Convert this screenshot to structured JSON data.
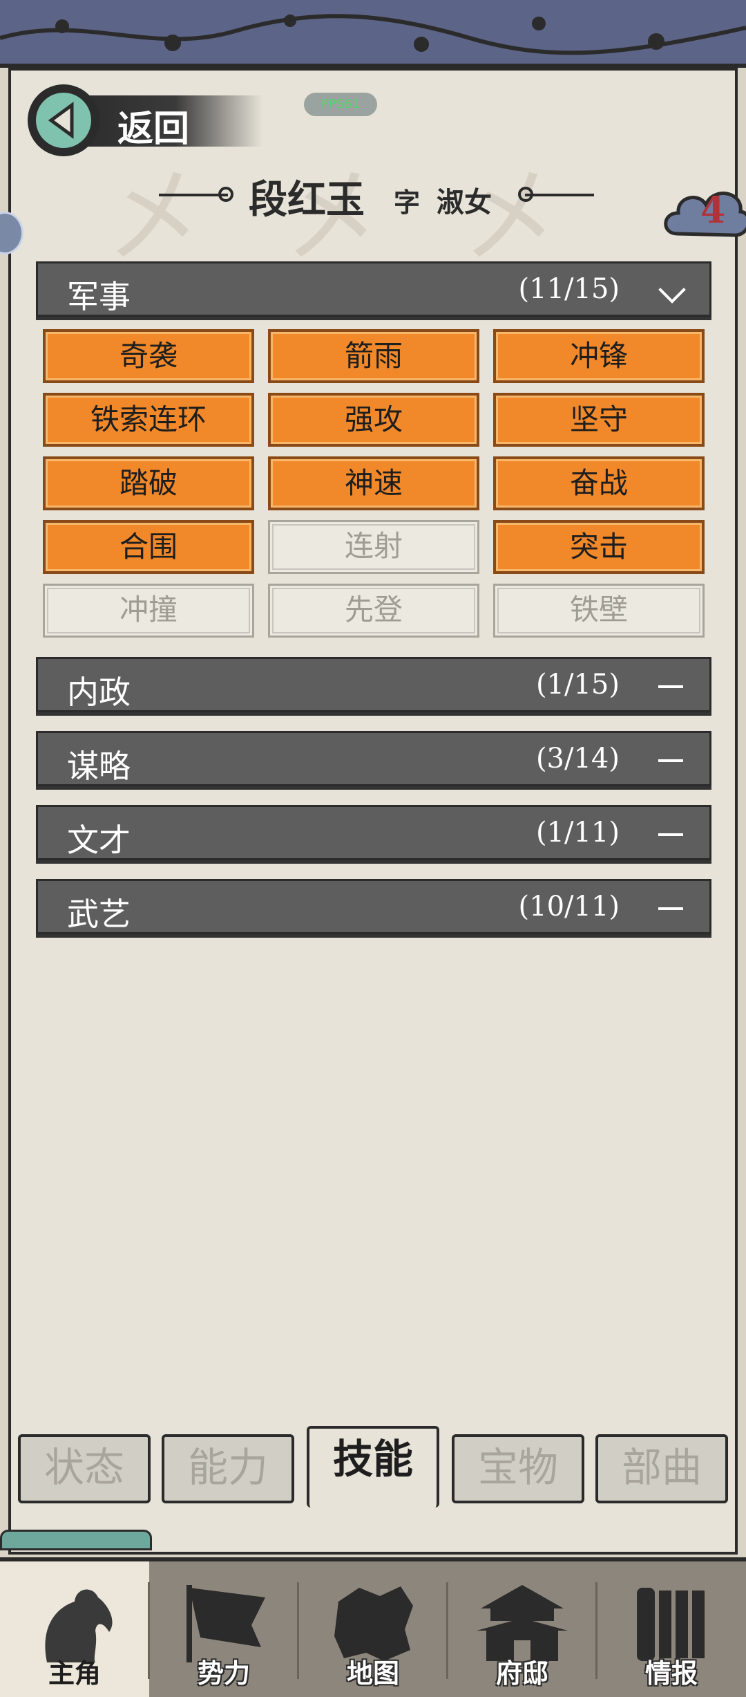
{
  "status": {
    "fps": "FPS61"
  },
  "header": {
    "back_label": "返回",
    "name": "段红玉",
    "courtesy_label": "字",
    "courtesy_name": "淑女",
    "badge_count": "4"
  },
  "sections": [
    {
      "label": "军事",
      "count": "(11/15)",
      "expanded": true
    },
    {
      "label": "内政",
      "count": "(1/15)",
      "expanded": false
    },
    {
      "label": "谋略",
      "count": "(3/14)",
      "expanded": false
    },
    {
      "label": "文才",
      "count": "(1/11)",
      "expanded": false
    },
    {
      "label": "武艺",
      "count": "(10/11)",
      "expanded": false
    }
  ],
  "military_skills": [
    {
      "name": "奇袭",
      "learned": true
    },
    {
      "name": "箭雨",
      "learned": true
    },
    {
      "name": "冲锋",
      "learned": true
    },
    {
      "name": "铁索连环",
      "learned": true
    },
    {
      "name": "强攻",
      "learned": true
    },
    {
      "name": "坚守",
      "learned": true
    },
    {
      "name": "踏破",
      "learned": true
    },
    {
      "name": "神速",
      "learned": true
    },
    {
      "name": "奋战",
      "learned": true
    },
    {
      "name": "合围",
      "learned": true
    },
    {
      "name": "连射",
      "learned": false
    },
    {
      "name": "突击",
      "learned": true
    },
    {
      "name": "冲撞",
      "learned": false
    },
    {
      "name": "先登",
      "learned": false
    },
    {
      "name": "铁壁",
      "learned": false
    }
  ],
  "sub_tabs": [
    {
      "label": "状态",
      "active": false
    },
    {
      "label": "能力",
      "active": false
    },
    {
      "label": "技能",
      "active": true
    },
    {
      "label": "宝物",
      "active": false
    },
    {
      "label": "部曲",
      "active": false
    }
  ],
  "bottom_nav": [
    {
      "label": "主角",
      "icon": "hero-icon",
      "active": true
    },
    {
      "label": "势力",
      "icon": "flag-icon",
      "active": false
    },
    {
      "label": "地图",
      "icon": "map-icon",
      "active": false
    },
    {
      "label": "府邸",
      "icon": "mansion-icon",
      "active": false
    },
    {
      "label": "情报",
      "icon": "scroll-icon",
      "active": false
    }
  ],
  "colors": {
    "learned_skill": "#f1892a",
    "section_bar": "#5e5e5e",
    "badge_text": "#b0333a",
    "back_button": "#7fc2ad"
  }
}
